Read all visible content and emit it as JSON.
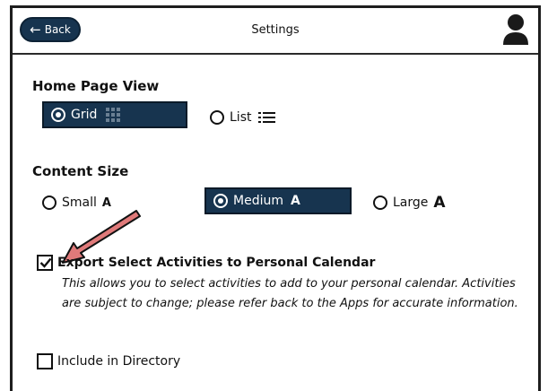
{
  "header": {
    "back_label": "Back",
    "title": "Settings"
  },
  "home_page_view": {
    "title": "Home Page View",
    "options": [
      {
        "label": "Grid",
        "icon": "grid-icon",
        "selected": true
      },
      {
        "label": "List",
        "icon": "list-icon",
        "selected": false
      }
    ]
  },
  "content_size": {
    "title": "Content Size",
    "options": [
      {
        "label": "Small",
        "marker": "A",
        "selected": false
      },
      {
        "label": "Medium",
        "marker": "A",
        "selected": true
      },
      {
        "label": "Large",
        "marker": "A",
        "selected": false
      }
    ]
  },
  "export_calendar": {
    "label": "Export Select Activities to Personal Calendar",
    "checked": true,
    "description": "This allows you to select activities to add to your personal calendar. Activities are subject to change; please refer back to the Apps for accurate information."
  },
  "include_directory": {
    "label": "Include in Directory",
    "checked": false
  },
  "colors": {
    "accent": "#17344f",
    "annotation_arrow": "#e07a7a"
  }
}
